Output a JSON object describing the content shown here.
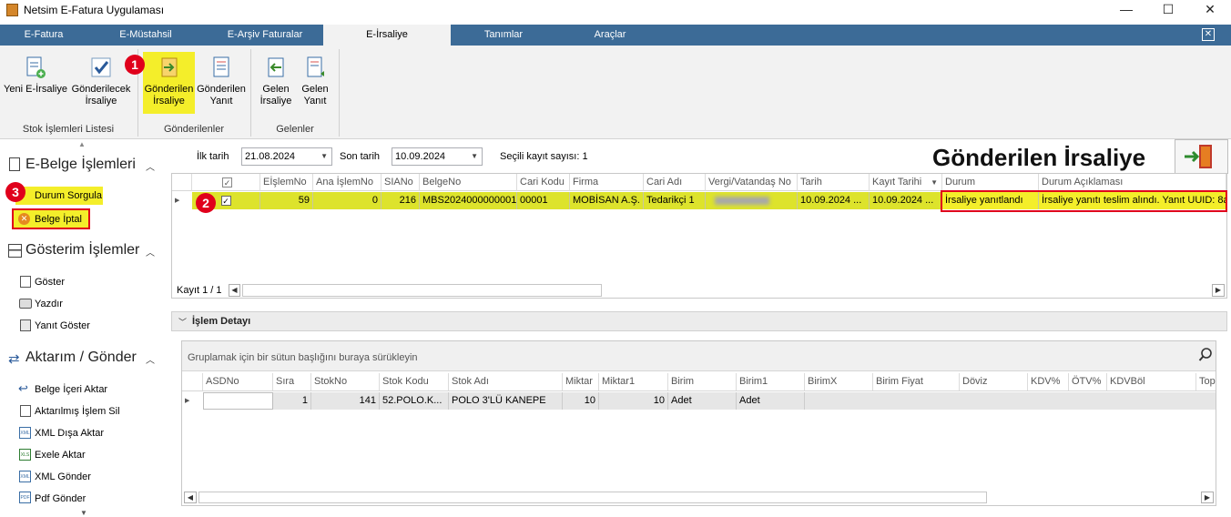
{
  "window": {
    "title": "Netsim E-Fatura Uygulaması",
    "minimize": "—",
    "maximize": "☐",
    "close": "✕"
  },
  "tabs": [
    "E-Fatura",
    "E-Müstahsil",
    "E-Arşiv Faturalar",
    "E-İrsaliye",
    "Tanımlar",
    "Araçlar"
  ],
  "active_tab": "E-İrsaliye",
  "ribbon": {
    "groups": [
      {
        "label": "Stok İşlemleri Listesi",
        "buttons": [
          {
            "l1": "Yeni E-İrsaliye",
            "l2": ""
          },
          {
            "l1": "Gönderilecek",
            "l2": "İrsaliye"
          }
        ]
      },
      {
        "label": "Gönderilenler",
        "buttons": [
          {
            "l1": "Gönderilen",
            "l2": "İrsaliye"
          },
          {
            "l1": "Gönderilen",
            "l2": "Yanıt"
          }
        ]
      },
      {
        "label": "Gelenler",
        "buttons": [
          {
            "l1": "Gelen",
            "l2": "İrsaliye"
          },
          {
            "l1": "Gelen",
            "l2": "Yanıt"
          }
        ]
      }
    ]
  },
  "callouts": [
    "1",
    "2",
    "3"
  ],
  "left": {
    "sections": [
      {
        "title": "E-Belge İşlemleri",
        "items": [
          "Durum Sorgula",
          "Belge İptal"
        ]
      },
      {
        "title": "Gösterim İşlemler",
        "items": [
          "Göster",
          "Yazdır",
          "Yanıt Göster"
        ]
      },
      {
        "title": "Aktarım / Gönder",
        "items": [
          "Belge İçeri Aktar",
          "Aktarılmış İşlem Sil",
          "XML Dışa Aktar",
          "Exele Aktar",
          "XML Gönder",
          "Pdf Gönder"
        ]
      }
    ]
  },
  "filters": {
    "start_label": "İlk tarih",
    "start_value": "21.08.2024",
    "end_label": "Son tarih",
    "end_value": "10.09.2024",
    "selected_count": "Seçili kayıt sayısı: 1"
  },
  "page_heading": "Gönderilen İrsaliye",
  "main_grid": {
    "columns": [
      "",
      "EİşlemNo",
      "Ana İşlemNo",
      "SIANo",
      "BelgeNo",
      "Cari Kodu",
      "Firma",
      "Cari Adı",
      "Vergi/Vatandaş No",
      "Tarih",
      "Kayıt Tarihi",
      "Durum",
      "Durum Açıklaması"
    ],
    "row": {
      "checked": true,
      "EIslemNo": "59",
      "AnaIslemNo": "0",
      "SIANo": "216",
      "BelgeNo": "MBS2024000000001",
      "CariKodu": "00001",
      "Firma": "MOBİSAN A.Ş.",
      "CariAdi": "Tedarikçi 1",
      "VergiNo": "",
      "Tarih": "10.09.2024 ...",
      "KayitTarihi": "10.09.2024 ...",
      "Durum": "İrsaliye yanıtlandı",
      "DurumAciklamasi": "İrsaliye yanıtı teslim alındı. Yanıt UUID: 8a"
    },
    "record_nav": "Kayıt 1 / 1"
  },
  "detail": {
    "title": "İşlem Detayı",
    "group_hint": "Gruplamak için bir sütun başlığını buraya sürükleyin",
    "columns": [
      "ASDNo",
      "Sıra",
      "StokNo",
      "Stok Kodu",
      "Stok Adı",
      "Miktar",
      "Miktar1",
      "Birim",
      "Birim1",
      "BirimX",
      "Birim Fiyat",
      "Döviz",
      "KDV%",
      "ÖTV%",
      "KDVBöl",
      "Top"
    ],
    "row": {
      "ASDNo": "",
      "Sira": "1",
      "StokNo": "141",
      "StokKodu": "52.POLO.K...",
      "StokAdi": "POLO 3'LÜ KANEPE",
      "Miktar": "10",
      "Miktar1": "10",
      "Birim": "Adet",
      "Birim1": "Adet"
    }
  },
  "colors": {
    "tabbar": "#3c6b97",
    "highlight": "#d9e021",
    "callout": "#e0001b"
  }
}
